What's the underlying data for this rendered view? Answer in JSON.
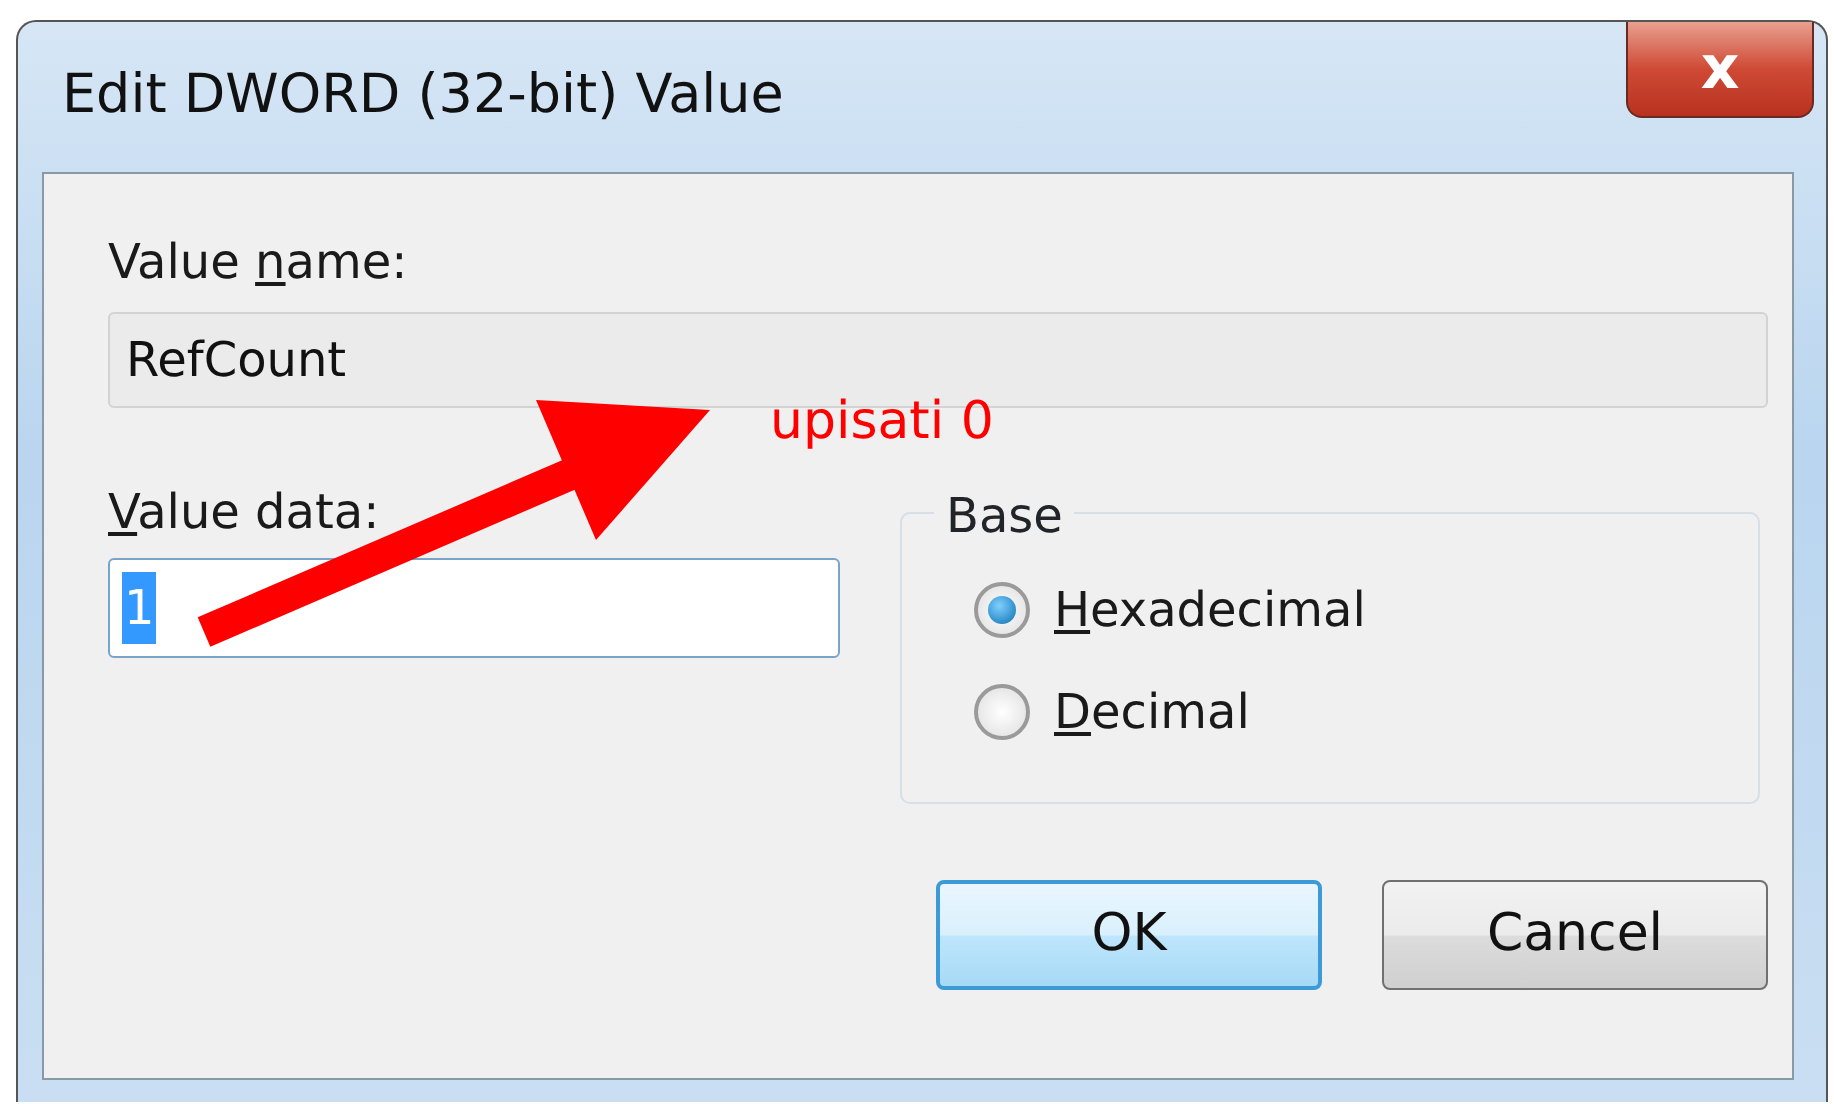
{
  "window": {
    "title": "Edit DWORD (32-bit) Value",
    "close_symbol": "x"
  },
  "value_name": {
    "label": {
      "before": "Value ",
      "accel": "n",
      "after": "ame:"
    },
    "value": "RefCount",
    "readonly": true
  },
  "value_data": {
    "label": {
      "accel": "V",
      "after": "alue data:"
    },
    "value": "1",
    "selected_text": true
  },
  "base": {
    "title": "Base",
    "options": [
      {
        "label": {
          "accel": "H",
          "after": "exadecimal"
        },
        "selected": true
      },
      {
        "label": {
          "accel": "D",
          "after": "ecimal"
        },
        "selected": false
      }
    ]
  },
  "buttons": [
    {
      "label": "OK",
      "default": true
    },
    {
      "label": "Cancel",
      "default": false
    }
  ],
  "annotation": {
    "text": "upisati 0",
    "color": "#ff0000"
  }
}
